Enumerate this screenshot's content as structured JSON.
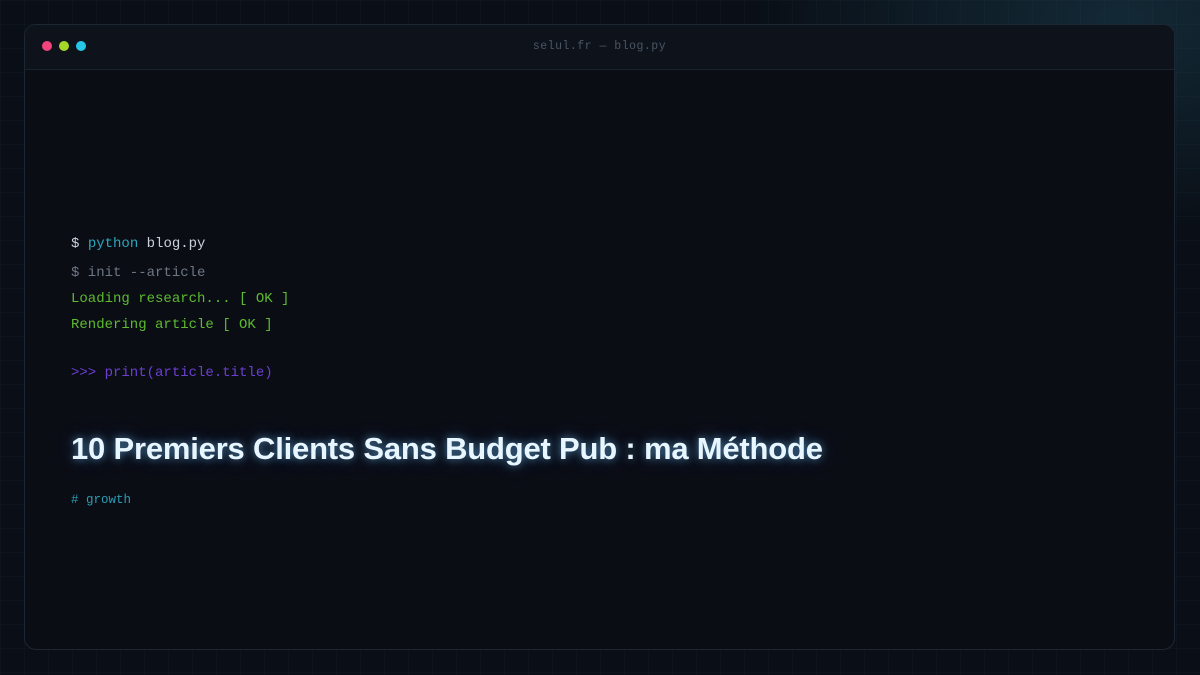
{
  "window": {
    "title": "selul.fr — blog.py"
  },
  "terminal": {
    "prompt_symbol": "$",
    "command_keyword": "python",
    "command_arg": "blog.py",
    "init_line": "$ init --article",
    "status_research": "Loading research... [ OK ]",
    "status_render": "Rendering article [ OK ]",
    "repl_line": ">>> print(article.title)"
  },
  "article": {
    "title": "10 Premiers Clients Sans Budget Pub : ma Méthode",
    "tag": "# growth"
  },
  "colors": {
    "dot_close": "#f2437c",
    "dot_minimize": "#a6d62a",
    "dot_maximize": "#26c8e6",
    "ok_green": "#5dbb2f",
    "repl_purple": "#6a3fd1",
    "accent_cyan": "#2aa7bd"
  }
}
